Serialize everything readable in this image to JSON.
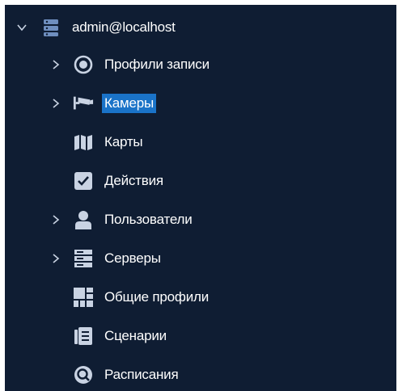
{
  "tree": {
    "root": {
      "label": "admin@localhost",
      "expanded": true,
      "icon": "server-stack-icon"
    },
    "items": [
      {
        "label": "Профили записи",
        "icon": "record-profile-icon",
        "expandable": true,
        "selected": false
      },
      {
        "label": "Камеры",
        "icon": "camera-icon",
        "expandable": true,
        "selected": true
      },
      {
        "label": "Карты",
        "icon": "map-icon",
        "expandable": false,
        "selected": false
      },
      {
        "label": "Действия",
        "icon": "checkbox-icon",
        "expandable": false,
        "selected": false
      },
      {
        "label": "Пользователи",
        "icon": "user-icon",
        "expandable": true,
        "selected": false
      },
      {
        "label": "Серверы",
        "icon": "servers-icon",
        "expandable": true,
        "selected": false
      },
      {
        "label": "Общие профили",
        "icon": "grid-profile-icon",
        "expandable": false,
        "selected": false
      },
      {
        "label": "Сценарии",
        "icon": "scenario-icon",
        "expandable": false,
        "selected": false
      },
      {
        "label": "Расписания",
        "icon": "schedule-icon",
        "expandable": false,
        "selected": false
      }
    ]
  },
  "colors": {
    "background": "#0f1d33",
    "selection": "#1a73c8",
    "icon": "#c9d3e3",
    "text": "#ffffff"
  }
}
